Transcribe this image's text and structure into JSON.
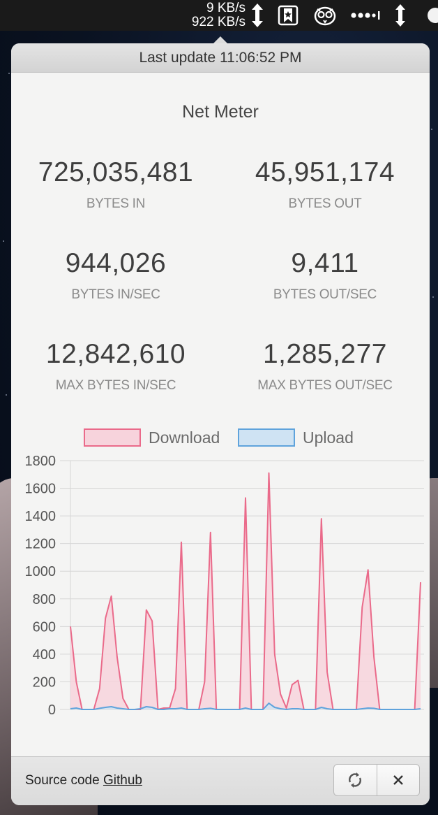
{
  "menubar": {
    "rate_top": "9 KB/s",
    "rate_bottom": "922 KB/s",
    "icons": [
      "updown-arrow-icon",
      "bookmark-star-icon",
      "owl-icon",
      "dots-menu-icon",
      "updown-arrow-icon"
    ]
  },
  "header": {
    "last_update": "Last update 11:06:52 PM"
  },
  "app": {
    "title": "Net Meter"
  },
  "stats": {
    "bytes_in": {
      "value": "725,035,481",
      "label": "BYTES IN"
    },
    "bytes_out": {
      "value": "45,951,174",
      "label": "BYTES OUT"
    },
    "bytes_in_sec": {
      "value": "944,026",
      "label": "BYTES IN/SEC"
    },
    "bytes_out_sec": {
      "value": "9,411",
      "label": "BYTES OUT/SEC"
    },
    "max_in_sec": {
      "value": "12,842,610",
      "label": "MAX BYTES IN/SEC"
    },
    "max_out_sec": {
      "value": "1,285,277",
      "label": "MAX BYTES OUT/SEC"
    }
  },
  "colors": {
    "download_line": "#ea6a8a",
    "download_fill": "#f7d3dc",
    "upload_line": "#5fa3dc",
    "upload_fill": "#cfe3f3",
    "grid": "#d6d6d6"
  },
  "chart_data": {
    "type": "area",
    "ylim": [
      0,
      1800
    ],
    "yticks": [
      "0",
      "200",
      "400",
      "600",
      "800",
      "1000",
      "1200",
      "1400",
      "1600",
      "1800"
    ],
    "legend": [
      "Download",
      "Upload"
    ],
    "series": [
      {
        "name": "Download",
        "values": [
          600,
          200,
          0,
          0,
          0,
          150,
          660,
          820,
          380,
          80,
          0,
          0,
          0,
          720,
          640,
          0,
          10,
          10,
          150,
          1210,
          0,
          0,
          0,
          200,
          1280,
          0,
          0,
          0,
          0,
          0,
          1530,
          0,
          0,
          0,
          1710,
          400,
          110,
          10,
          180,
          210,
          0,
          0,
          0,
          1380,
          270,
          0,
          0,
          0,
          0,
          0,
          740,
          1010,
          380,
          0,
          0,
          0,
          0,
          0,
          0,
          0,
          920
        ]
      },
      {
        "name": "Upload",
        "values": [
          5,
          10,
          0,
          0,
          0,
          8,
          15,
          20,
          10,
          5,
          0,
          0,
          5,
          20,
          15,
          0,
          0,
          5,
          5,
          10,
          0,
          0,
          0,
          5,
          8,
          0,
          0,
          0,
          0,
          0,
          10,
          0,
          0,
          0,
          45,
          15,
          5,
          0,
          5,
          5,
          0,
          0,
          0,
          15,
          5,
          0,
          0,
          0,
          0,
          0,
          5,
          10,
          8,
          0,
          0,
          0,
          0,
          0,
          0,
          0,
          5
        ]
      }
    ]
  },
  "footer": {
    "source_prefix": "Source code",
    "source_link": "Github"
  }
}
